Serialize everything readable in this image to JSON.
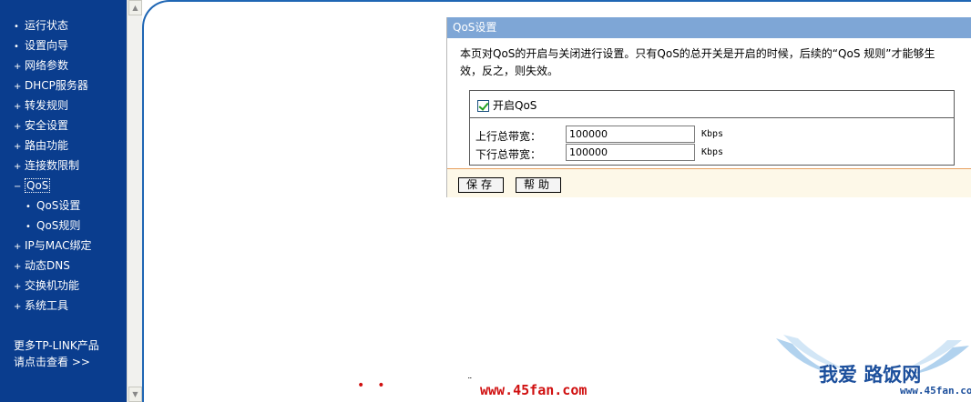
{
  "sidebar": {
    "items": [
      {
        "label": "运行状态",
        "bullet": "•"
      },
      {
        "label": "设置向导",
        "bullet": "•"
      },
      {
        "label": "网络参数",
        "bullet": "+"
      },
      {
        "label": "DHCP服务器",
        "bullet": "+"
      },
      {
        "label": "转发规则",
        "bullet": "+"
      },
      {
        "label": "安全设置",
        "bullet": "+"
      },
      {
        "label": "路由功能",
        "bullet": "+"
      },
      {
        "label": "连接数限制",
        "bullet": "+"
      },
      {
        "label": "QoS",
        "bullet": "−"
      },
      {
        "label": "QoS设置",
        "bullet": "•"
      },
      {
        "label": "QoS规则",
        "bullet": "•"
      },
      {
        "label": "IP与MAC绑定",
        "bullet": "+"
      },
      {
        "label": "动态DNS",
        "bullet": "+"
      },
      {
        "label": "交换机功能",
        "bullet": "+"
      },
      {
        "label": "系统工具",
        "bullet": "+"
      }
    ],
    "more_line1": "更多TP-LINK产品",
    "more_line2": "请点击查看 >>"
  },
  "panel": {
    "title": "QoS设置",
    "description": "本页对QoS的开启与关闭进行设置。只有QoS的总开关是开启的时候，后续的“QoS 规则”才能够生效，反之，则失效。",
    "enable_label": "开启QoS",
    "enable_checked": true,
    "upload_label": "上行总带宽：",
    "upload_value": "100000",
    "download_label": "下行总带宽：",
    "download_value": "100000",
    "unit": "Kbps",
    "save_label": "保存",
    "help_label": "帮助"
  },
  "watermark": {
    "url": "www.45fan.com",
    "logo_text": "我爱",
    "logo_brand": "路饭网",
    "logo_sub": "www.45fan.com"
  },
  "colors": {
    "sidebar_bg": "#0a3d8e",
    "panel_header": "#7ea6d6",
    "panel_bg": "#fdf8e8",
    "accent_border": "#e8a060",
    "watermark_red": "#d01010"
  }
}
